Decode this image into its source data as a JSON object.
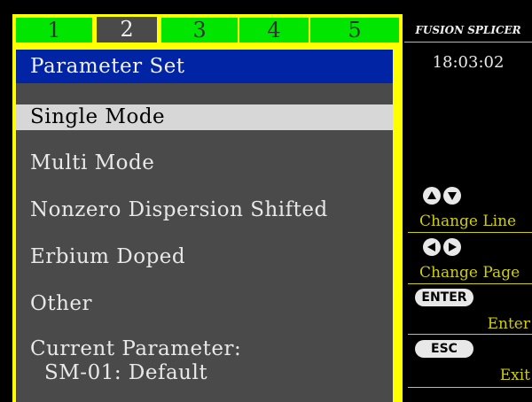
{
  "tabs": [
    "1",
    "2",
    "3",
    "4",
    "5"
  ],
  "active_tab": "2",
  "header": {
    "title": "Parameter Set"
  },
  "menu": {
    "items": [
      {
        "label": "Single Mode",
        "selected": true
      },
      {
        "label": "Multi Mode",
        "selected": false
      },
      {
        "label": "Nonzero Dispersion Shifted",
        "selected": false
      },
      {
        "label": "Erbium Doped",
        "selected": false
      },
      {
        "label": "Other",
        "selected": false
      }
    ]
  },
  "current": {
    "label": "Current Parameter:",
    "value": "SM-01: Default"
  },
  "side": {
    "brand": "FUSION SPLICER",
    "time": "18:03:02",
    "change_line": "Change Line",
    "change_page": "Change Page",
    "enter_key": "ENTER",
    "enter_label": "Enter",
    "esc_key": "ESC",
    "exit_label": "Exit"
  },
  "colors": {
    "frame": "#ffff00",
    "tab": "#00e600",
    "title_bar": "#0024a3",
    "panel": "#4a4a4a",
    "selection": "#d7d7d7",
    "side_text": "#cfcf00"
  },
  "icons": [
    "up-arrow-icon",
    "down-arrow-icon",
    "left-arrow-icon",
    "right-arrow-icon"
  ]
}
